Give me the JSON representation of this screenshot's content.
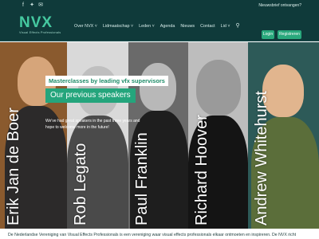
{
  "topbar": {
    "social": [
      {
        "icon": "facebook-icon",
        "glyph": "f"
      },
      {
        "icon": "twitter-icon",
        "glyph": "✦"
      },
      {
        "icon": "email-icon",
        "glyph": "✉"
      }
    ],
    "newsletter_label": "Nieuwsbrief ontvangen?"
  },
  "logo": {
    "text": "NVX",
    "sub": "Visual Effects Professionals"
  },
  "nav": {
    "items": [
      "Over NVX ˅",
      "Lidmaatschap ˅",
      "Leden ˅",
      "Agenda",
      "Nieuws",
      "Contact",
      "Lid ˅"
    ],
    "search_icon": "search-icon"
  },
  "auth": {
    "login_label": "Login",
    "register_label": "Registreren"
  },
  "hero": {
    "sub_title": "Masterclasses by leading vfx supervisors",
    "title": "Our previous speakers",
    "intro": "We've had great speakers in the past three years and hope to welcome more in the future!",
    "speakers": [
      {
        "name": "Erik Jan de Boer",
        "bg": "#8a5a2e",
        "skin": "#d6a57a",
        "shirt": "#2c2a2a"
      },
      {
        "name": "Rob Legato",
        "bg": "#d9d9d9",
        "skin": "#bfbfbf",
        "shirt": "#4a4a4a"
      },
      {
        "name": "Paul Franklin",
        "bg": "#6a6a6a",
        "skin": "#b8b8b8",
        "shirt": "#1e1e1e"
      },
      {
        "name": "Richard Hoover",
        "bg": "#bdbdbd",
        "skin": "#9a9a9a",
        "shirt": "#141414"
      },
      {
        "name": "Andrew Whitehurst",
        "bg": "#2d5a58",
        "skin": "#e1b58e",
        "shirt": "#5b6e3a"
      }
    ]
  },
  "footer": {
    "text": "De Nederlandse Vereniging van Visual Effects Professionals is een vereniging waar visual effects professionals elkaar ontmoeten en inspireren. De NVX richt"
  }
}
